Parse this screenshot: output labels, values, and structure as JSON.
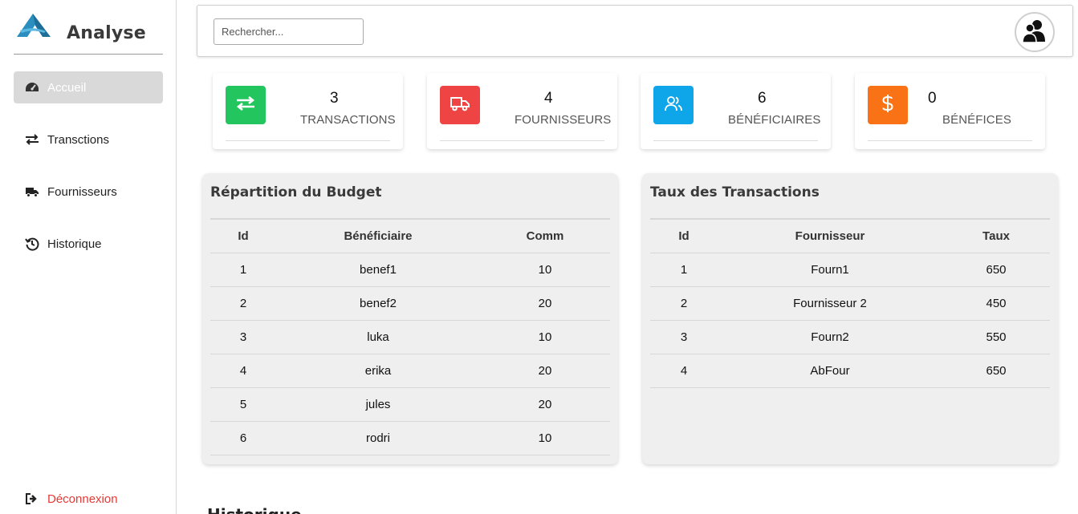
{
  "sidebar": {
    "brand": "Analyse",
    "items": [
      {
        "label": "Accueil",
        "icon": "gauge-icon"
      },
      {
        "label": "Transctions",
        "icon": "arrows-exchange-icon"
      },
      {
        "label": "Fournisseurs",
        "icon": "truck-icon"
      },
      {
        "label": "Historique",
        "icon": "history-icon"
      }
    ],
    "logout": "Déconnexion"
  },
  "header": {
    "search_placeholder": "Rechercher...",
    "avatar_icon": "users-icon"
  },
  "stats": [
    {
      "value": "3",
      "label": "TRANSACTIONS",
      "color": "#22c55e",
      "icon": "arrows-exchange-icon"
    },
    {
      "value": "4",
      "label": "FOURNISSEURS",
      "color": "#ef4444",
      "icon": "truck-icon"
    },
    {
      "value": "6",
      "label": "BÉNÉFICIAIRES",
      "color": "#0ea5e9",
      "icon": "users-icon"
    },
    {
      "value": "0",
      "label": "BÉNÉFICES",
      "color": "#f97316",
      "icon": "dollar-icon"
    }
  ],
  "budget": {
    "title": "Répartition du Budget",
    "headers": [
      "Id",
      "Bénéficiaire",
      "Comm"
    ],
    "rows": [
      [
        "1",
        "benef1",
        "10"
      ],
      [
        "2",
        "benef2",
        "20"
      ],
      [
        "3",
        "luka",
        "10"
      ],
      [
        "4",
        "erika",
        "20"
      ],
      [
        "5",
        "jules",
        "20"
      ],
      [
        "6",
        "rodri",
        "10"
      ]
    ]
  },
  "rates": {
    "title": "Taux des Transactions",
    "headers": [
      "Id",
      "Fournisseur",
      "Taux"
    ],
    "rows": [
      [
        "1",
        "Fourn1",
        "650"
      ],
      [
        "2",
        "Fournisseur 2",
        "450"
      ],
      [
        "3",
        "Fourn2",
        "550"
      ],
      [
        "4",
        "AbFour",
        "650"
      ]
    ]
  },
  "history_heading": "Historique"
}
